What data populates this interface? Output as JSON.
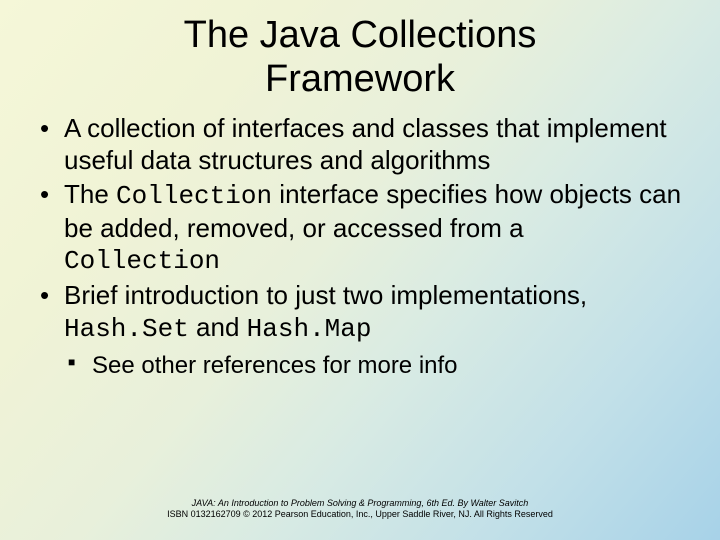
{
  "title_line1": "The Java Collections",
  "title_line2": "Framework",
  "bullets": {
    "b1": "A collection of interfaces and classes that implement useful data structures and algorithms",
    "b2_pre": "The ",
    "b2_code1": "Collection",
    "b2_mid": " interface specifies how objects can be added, removed, or accessed from a ",
    "b2_code2": "Collection",
    "b3_pre": "Brief introduction to just two implementations, ",
    "b3_code1": "Hash.Set",
    "b3_mid": " and ",
    "b3_code2": "Hash.Map",
    "sub1": "See other references for more info"
  },
  "footer": {
    "line1": "JAVA: An Introduction to Problem Solving & Programming, 6th Ed. By Walter Savitch",
    "line2": "ISBN 0132162709 © 2012 Pearson Education, Inc., Upper Saddle River, NJ. All Rights Reserved"
  }
}
